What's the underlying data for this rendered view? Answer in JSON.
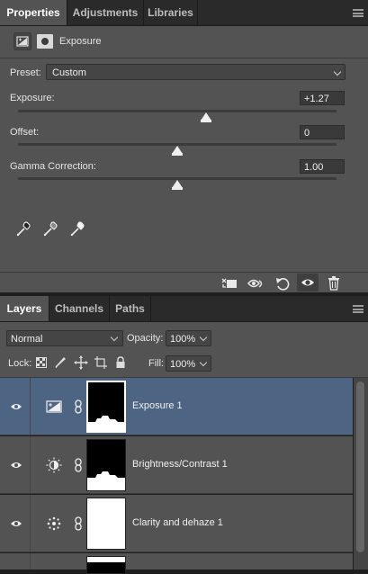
{
  "properties_panel": {
    "tabs": [
      {
        "label": "Properties",
        "active": true
      },
      {
        "label": "Adjustments",
        "active": false
      },
      {
        "label": "Libraries",
        "active": false
      }
    ],
    "adjustment_title": "Exposure",
    "preset": {
      "label": "Preset:",
      "value": "Custom"
    },
    "sliders": [
      {
        "label": "Exposure:",
        "value": "+1.27",
        "fraction": 0.59
      },
      {
        "label": "Offset:",
        "value": "0",
        "fraction": 0.5
      },
      {
        "label": "Gamma Correction:",
        "value": "1.00",
        "fraction": 0.5
      }
    ],
    "eyedroppers": [
      "black-point-eyedropper-icon",
      "gray-point-eyedropper-icon",
      "white-point-eyedropper-icon"
    ],
    "footer_icons": [
      "clip-to-layer-icon",
      "view-previous-state-icon",
      "reset-icon",
      "visibility-eye-icon",
      "trash-icon"
    ]
  },
  "layers_panel": {
    "tabs": [
      {
        "label": "Layers",
        "active": true
      },
      {
        "label": "Channels",
        "active": false
      },
      {
        "label": "Paths",
        "active": false
      }
    ],
    "blend_mode": "Normal",
    "opacity": {
      "label": "Opacity:",
      "value": "100%"
    },
    "lock_label": "Lock:",
    "fill": {
      "label": "Fill:",
      "value": "100%"
    },
    "layers": [
      {
        "name": "Exposure 1",
        "icon": "exposure-adjustment-icon",
        "selected": true,
        "mask": "black-with-white-bottom"
      },
      {
        "name": "Brightness/Contrast 1",
        "icon": "brightness-contrast-icon",
        "selected": false,
        "mask": "black-with-white-bottom"
      },
      {
        "name": "Clarity and dehaze 1",
        "icon": "clarity-icon",
        "selected": false,
        "mask": "white"
      }
    ]
  },
  "colors": {
    "panel": "#535353",
    "tabbar": "#2a2a2a",
    "selected_row": "#4d6582",
    "text": "#e4e4e4"
  }
}
